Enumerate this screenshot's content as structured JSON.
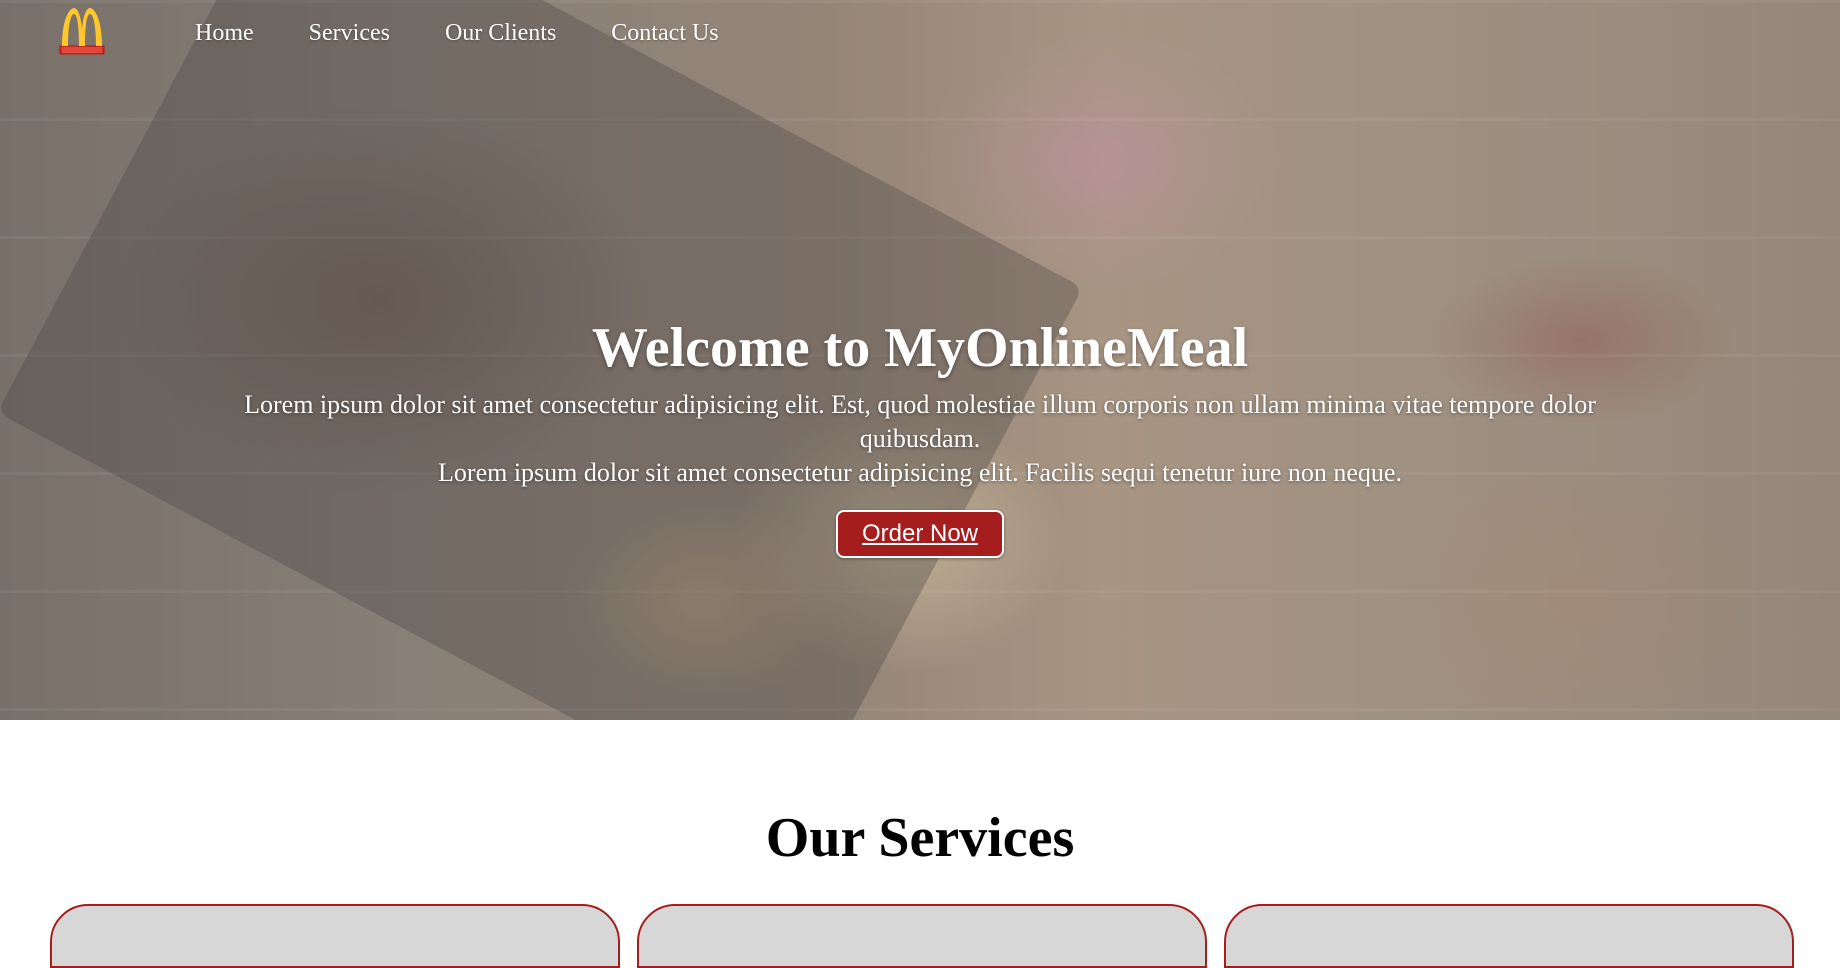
{
  "brand": {
    "logo_name": "McDonald's",
    "logo_colors": {
      "arches": "#ffc72c",
      "box": "#da291c"
    }
  },
  "nav": {
    "items": [
      {
        "label": "Home"
      },
      {
        "label": "Services"
      },
      {
        "label": "Our Clients"
      },
      {
        "label": "Contact Us"
      }
    ]
  },
  "hero": {
    "title": "Welcome to MyOnlineMeal",
    "text_line1": "Lorem ipsum dolor sit amet consectetur adipisicing elit. Est, quod molestiae illum corporis non ullam minima vitae tempore dolor quibusdam.",
    "text_line2": "Lorem ipsum dolor sit amet consectetur adipisicing elit. Facilis sequi tenetur iure non neque.",
    "button_label": "Order Now",
    "accent_color": "#a51d1d"
  },
  "services": {
    "title": "Our Services",
    "card_count": 3
  }
}
